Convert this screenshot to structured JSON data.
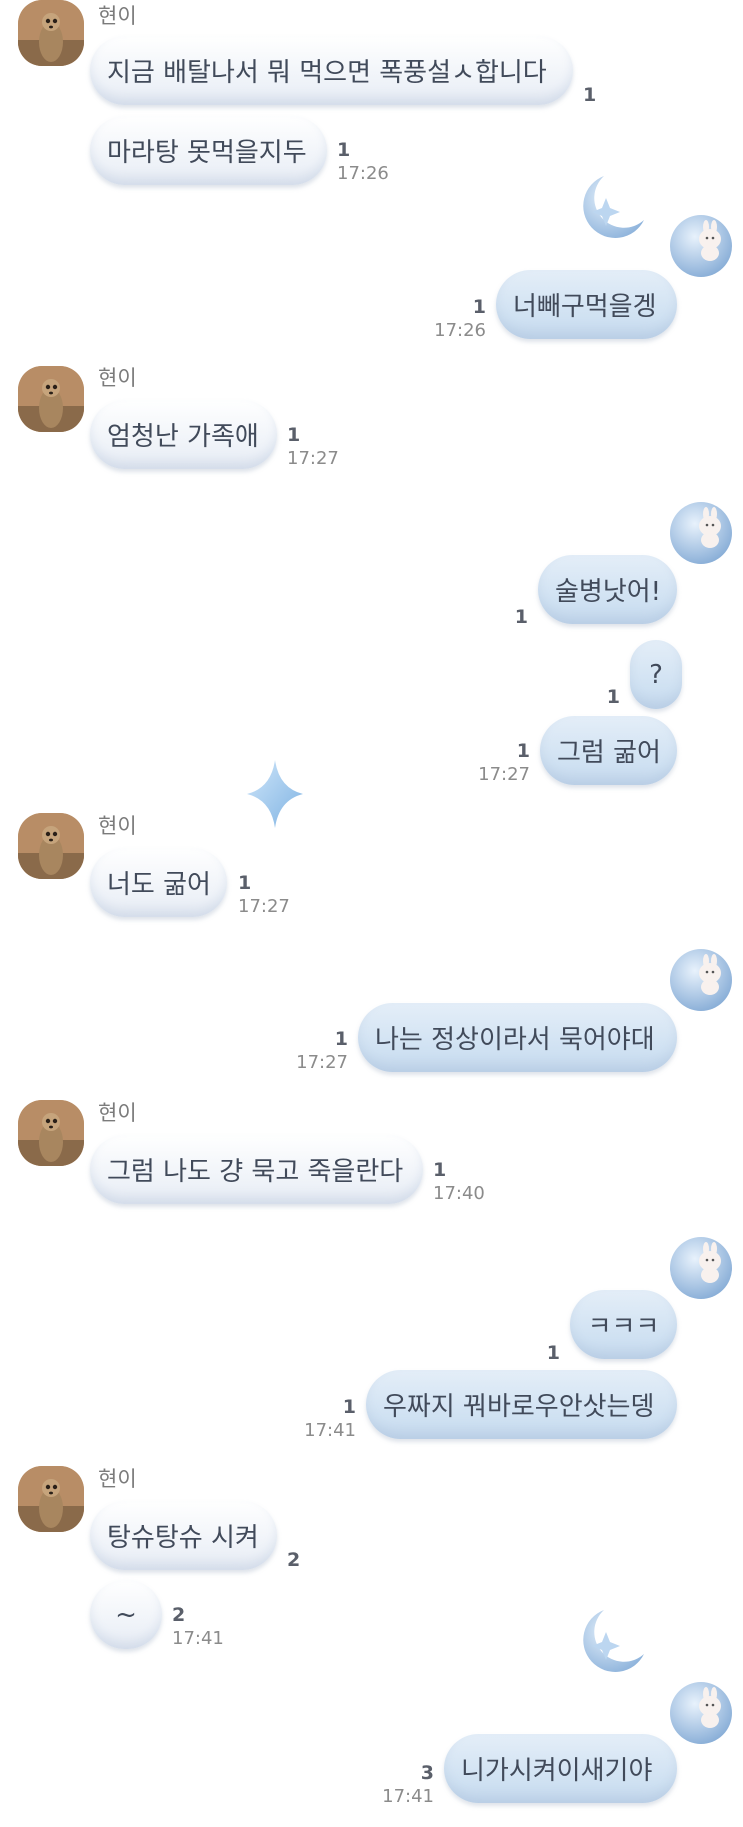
{
  "sender_name": "현이",
  "messages": [
    {
      "id": "m1",
      "dir": "in",
      "text": "지금 배탈나서 뭐 먹으면 폭풍설ㅅ합니다",
      "count": "1",
      "time": ""
    },
    {
      "id": "m2",
      "dir": "in",
      "text": "마라탕 못먹을지두",
      "count": "1",
      "time": "17:26"
    },
    {
      "id": "m3",
      "dir": "out",
      "text": "너빼구먹을겡",
      "count": "1",
      "time": "17:26"
    },
    {
      "id": "m4",
      "dir": "in",
      "text": "엄청난 가족애",
      "count": "1",
      "time": "17:27"
    },
    {
      "id": "m5",
      "dir": "out",
      "text": "술병낫어!",
      "count": "1",
      "time": ""
    },
    {
      "id": "m6",
      "dir": "out",
      "text": "?",
      "count": "1",
      "time": ""
    },
    {
      "id": "m7",
      "dir": "out",
      "text": "그럼 굶어",
      "count": "1",
      "time": "17:27"
    },
    {
      "id": "m8",
      "dir": "in",
      "text": "너도 굶어",
      "count": "1",
      "time": "17:27"
    },
    {
      "id": "m9",
      "dir": "out",
      "text": "나는 정상이라서 묵어야대",
      "count": "1",
      "time": "17:27"
    },
    {
      "id": "m10",
      "dir": "in",
      "text": "그럼 나도 걍 묵고 죽을란다",
      "count": "1",
      "time": "17:40"
    },
    {
      "id": "m11",
      "dir": "out",
      "text": "ㅋㅋㅋ",
      "count": "1",
      "time": ""
    },
    {
      "id": "m12",
      "dir": "out",
      "text": "우짜지 꿔바로우안삿는뎅",
      "count": "1",
      "time": "17:41"
    },
    {
      "id": "m13",
      "dir": "in",
      "text": "탕슈탕슈 시켜",
      "count": "2",
      "time": ""
    },
    {
      "id": "m14",
      "dir": "in",
      "text": "~",
      "count": "2",
      "time": "17:41"
    },
    {
      "id": "m15",
      "dir": "out",
      "text": "니가시켜이새기야",
      "count": "3",
      "time": "17:41"
    }
  ],
  "colors": {
    "incoming_bubble": "#eef2f8",
    "outgoing_bubble": "#cfe1f2",
    "text": "#414a5a",
    "meta_time": "#8b8b8b"
  },
  "icons": {
    "avatar": "meerkat-avatar-icon",
    "moon": "crescent-moon-icon",
    "bunny": "bunny-on-moon-icon",
    "sparkle": "blue-sparkle-icon"
  }
}
